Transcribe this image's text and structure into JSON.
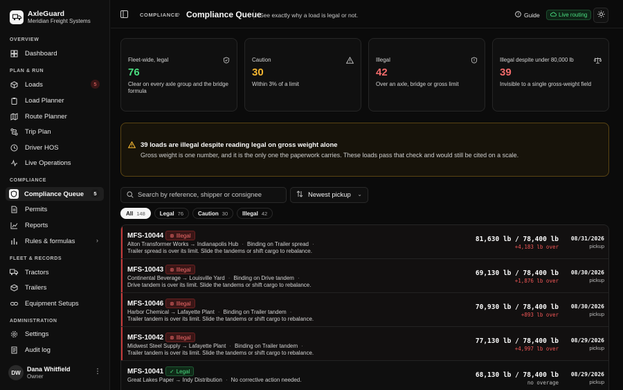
{
  "brand": {
    "name": "AxleGuard",
    "sub": "Meridian Freight Systems"
  },
  "nav": {
    "sections": {
      "overview": "OVERVIEW",
      "plan": "PLAN & RUN",
      "compliance": "COMPLIANCE",
      "fleet": "FLEET & RECORDS",
      "admin": "ADMINISTRATION"
    },
    "items": {
      "dashboard": "Dashboard",
      "loads": "Loads",
      "loads_badge": "5",
      "load_planner": "Load Planner",
      "route_planner": "Route Planner",
      "trip_plan": "Trip Plan",
      "driver_hos": "Driver HOS",
      "live_ops": "Live Operations",
      "compliance_queue": "Compliance Queue",
      "compliance_badge": "5",
      "permits": "Permits",
      "reports": "Reports",
      "rules": "Rules & formulas",
      "tractors": "Tractors",
      "trailers": "Trailers",
      "equipment": "Equipment Setups",
      "settings": "Settings",
      "audit": "Audit log"
    }
  },
  "user": {
    "initials": "DW",
    "name": "Dana Whitfield",
    "role": "Owner"
  },
  "header": {
    "crumb": "COMPLIANCE",
    "title": "Compliance Queue",
    "subtitle": "See exactly why a load is legal or not.",
    "guide": "Guide",
    "live": "Live routing"
  },
  "cards": [
    {
      "label": "Fleet-wide, legal",
      "value": "76",
      "desc": "Clear on every axle group and the bridge formula",
      "color": "#4ade80"
    },
    {
      "label": "Caution",
      "value": "30",
      "desc": "Within 3% of a limit",
      "color": "#f5b731"
    },
    {
      "label": "Illegal",
      "value": "42",
      "desc": "Over an axle, bridge or gross limit",
      "color": "#f26b6b"
    },
    {
      "label": "Illegal despite under 80,000 lb",
      "value": "39",
      "desc": "Invisible to a single gross-weight field",
      "color": "#f26b6b"
    }
  ],
  "alert": {
    "title": "39 loads are illegal despite reading legal on gross weight alone",
    "body": "Gross weight is one number, and it is the only one the paperwork carries. These loads pass that check and would still be cited on a scale."
  },
  "search": {
    "placeholder": "Search by reference, shipper or consignee"
  },
  "sort": {
    "label": "Newest pickup"
  },
  "tabs": [
    {
      "label": "All",
      "count": "148"
    },
    {
      "label": "Legal",
      "count": "76"
    },
    {
      "label": "Caution",
      "count": "30"
    },
    {
      "label": "Illegal",
      "count": "42"
    }
  ],
  "rows": [
    {
      "id": "MFS-10044",
      "status": "Illegal",
      "route": "Alton Transformer Works → Indianapolis Hub",
      "binding": "Binding on Trailer spread",
      "msg": "Trailer spread is over its limit. Slide the tandems or shift cargo to rebalance.",
      "weight": "81,630 lb / 78,400 lb",
      "over": "+4,183 lb over",
      "date": "08/31/2026",
      "pickup": "pickup"
    },
    {
      "id": "MFS-10043",
      "status": "Illegal",
      "route": "Continental Beverage → Louisville Yard",
      "binding": "Binding on Drive tandem",
      "msg": "Drive tandem is over its limit. Slide the tandems or shift cargo to rebalance.",
      "weight": "69,130 lb / 78,400 lb",
      "over": "+1,876 lb over",
      "date": "08/30/2026",
      "pickup": "pickup"
    },
    {
      "id": "MFS-10046",
      "status": "Illegal",
      "route": "Harbor Chemical → Lafayette Plant",
      "binding": "Binding on Trailer tandem",
      "msg": "Trailer tandem is over its limit. Slide the tandems or shift cargo to rebalance.",
      "weight": "70,930 lb / 78,400 lb",
      "over": "+893 lb over",
      "date": "08/30/2026",
      "pickup": "pickup"
    },
    {
      "id": "MFS-10042",
      "status": "Illegal",
      "route": "Midwest Steel Supply → Lafayette Plant",
      "binding": "Binding on Trailer tandem",
      "msg": "Trailer tandem is over its limit. Slide the tandems or shift cargo to rebalance.",
      "weight": "77,130 lb / 78,400 lb",
      "over": "+4,997 lb over",
      "date": "08/29/2026",
      "pickup": "pickup"
    },
    {
      "id": "MFS-10041",
      "status": "Legal",
      "route": "Great Lakes Paper → Indy Distribution",
      "binding": "No corrective action needed.",
      "msg": "",
      "weight": "68,130 lb / 78,400 lb",
      "over": "no overage",
      "date": "08/29/2026",
      "pickup": "pickup"
    }
  ]
}
